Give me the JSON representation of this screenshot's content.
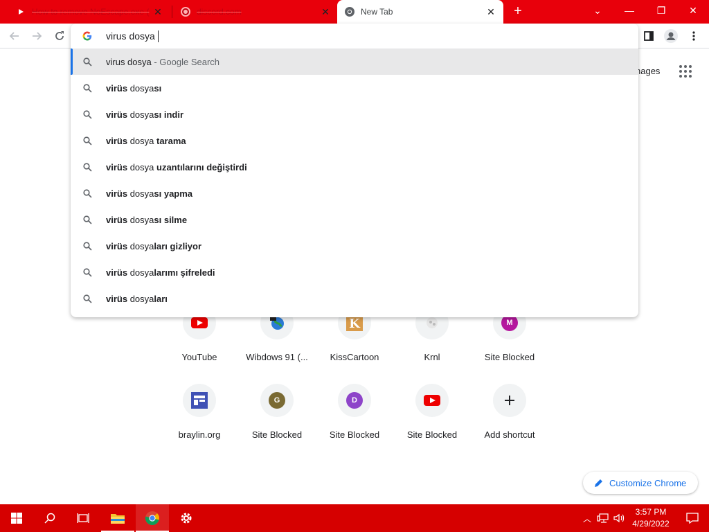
{
  "tabs": [
    {
      "title": "How to remove NoEscape.exe (",
      "close": "✕"
    },
    {
      "title": "discord.com",
      "close": "✕"
    },
    {
      "title": "New Tab",
      "close": "✕"
    }
  ],
  "new_tab": "+",
  "window_controls": {
    "minimize": "—",
    "restore": "❐",
    "close": "✕",
    "tab_search": "⌄"
  },
  "omnibox": {
    "value": "virus dosya",
    "suggestions": [
      {
        "bold_prefix": "",
        "plain": "virus dosya",
        "bold_suffix": "",
        "muted": " - Google Search"
      },
      {
        "bold_prefix": "virüs",
        "plain": " dosya",
        "bold_suffix": "sı",
        "muted": ""
      },
      {
        "bold_prefix": "virüs",
        "plain": " dosya",
        "bold_suffix": "sı indir",
        "muted": ""
      },
      {
        "bold_prefix": "virüs",
        "plain": " dosya",
        "bold_suffix": " tarama",
        "muted": ""
      },
      {
        "bold_prefix": "virüs",
        "plain": " dosya",
        "bold_suffix": " uzantılarını değiştirdi",
        "muted": ""
      },
      {
        "bold_prefix": "virüs",
        "plain": " dosya",
        "bold_suffix": "sı yapma",
        "muted": ""
      },
      {
        "bold_prefix": "virüs",
        "plain": " dosya",
        "bold_suffix": "sı silme",
        "muted": ""
      },
      {
        "bold_prefix": "virüs",
        "plain": " dosya",
        "bold_suffix": "ları gizliyor",
        "muted": ""
      },
      {
        "bold_prefix": "virüs",
        "plain": " dosya",
        "bold_suffix": "larımı şifreledi",
        "muted": ""
      },
      {
        "bold_prefix": "virüs",
        "plain": " dosya",
        "bold_suffix": "ları",
        "muted": ""
      }
    ]
  },
  "header": {
    "images_link": "nages"
  },
  "shortcuts_row1": [
    {
      "label": "YouTube",
      "icon": "youtube-icon"
    },
    {
      "label": "Wibdows 91 (...",
      "icon": "globe-icon"
    },
    {
      "label": "KissCartoon",
      "icon": "kisscartoon-icon"
    },
    {
      "label": "Krnl",
      "icon": "krnl-icon"
    },
    {
      "label": "Site Blocked",
      "icon": "letter-icon",
      "letter": "M",
      "color": "#b5179e"
    }
  ],
  "shortcuts_row2": [
    {
      "label": "braylin.org",
      "icon": "braylin-icon"
    },
    {
      "label": "Site Blocked",
      "icon": "letter-icon",
      "letter": "G",
      "color": "#7a6a33"
    },
    {
      "label": "Site Blocked",
      "icon": "letter-icon",
      "letter": "D",
      "color": "#8e44c9"
    },
    {
      "label": "Site Blocked",
      "icon": "youtube-icon"
    },
    {
      "label": "Add shortcut",
      "icon": "plus-icon"
    }
  ],
  "customize": {
    "label": "Customize Chrome"
  },
  "taskbar": {
    "time": "3:57 PM",
    "date": "4/29/2022"
  },
  "colors": {
    "accent": "#1a73e8",
    "titlebar": "#e8000b",
    "taskbar": "#d60000"
  }
}
